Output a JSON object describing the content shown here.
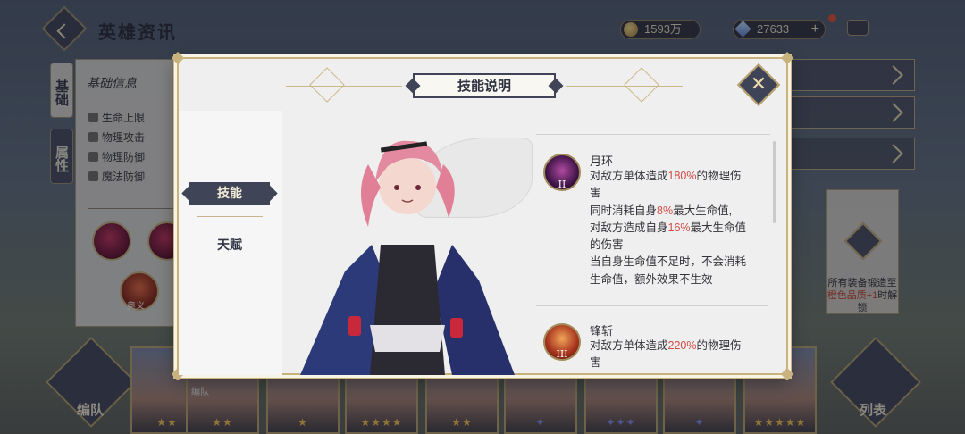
{
  "header": {
    "title": "英雄资讯",
    "gold": "1593万",
    "gems": "27633",
    "gems_plus": "+"
  },
  "left_tabs": [
    "基础",
    "属性"
  ],
  "info_panel": {
    "title": "基础信息",
    "stats": [
      "生命上限",
      "物理攻击",
      "物理防御",
      "魔法防御"
    ],
    "ult_label": "奥义"
  },
  "lock_panel": {
    "line1": "所有装备锻造至",
    "line2_warn": "橙色品质+1",
    "line2_rest": "时解",
    "line3": "锁"
  },
  "bottom": {
    "team_label": "编队",
    "team_label_small": "编队",
    "list_label": "列表"
  },
  "hero_strip": {
    "stars": [
      "★★",
      "★★",
      "★",
      "★★★★",
      "★★",
      "✦",
      "✦✦✦",
      "✦",
      "★★★★★"
    ]
  },
  "modal": {
    "title": "技能说明",
    "nav": {
      "skills_tab": "技能",
      "talent_tab": "天赋"
    },
    "skills": [
      {
        "icon_numeral": "II",
        "name": "月环",
        "lines": [
          {
            "pre": "对敌方单体造成",
            "hl": "180%",
            "post": "的物理伤"
          },
          {
            "pre": "害",
            "hl": "",
            "post": ""
          },
          {
            "pre": "同时消耗自身",
            "hl": "8%",
            "post": "最大生命值,"
          },
          {
            "pre": "对敌方造成自身",
            "hl": "16%",
            "post": "最大生命值"
          },
          {
            "pre": "的伤害",
            "hl": "",
            "post": ""
          },
          {
            "pre": "当自身生命值不足时，不会消耗",
            "hl": "",
            "post": ""
          },
          {
            "pre": "生命值，额外效果不生效",
            "hl": "",
            "post": ""
          }
        ]
      },
      {
        "icon_numeral": "III",
        "name": "锋斩",
        "lines": [
          {
            "pre": "对敌方单体造成",
            "hl": "220%",
            "post": "的物理伤"
          },
          {
            "pre": "害",
            "hl": "",
            "post": ""
          }
        ]
      }
    ]
  }
}
